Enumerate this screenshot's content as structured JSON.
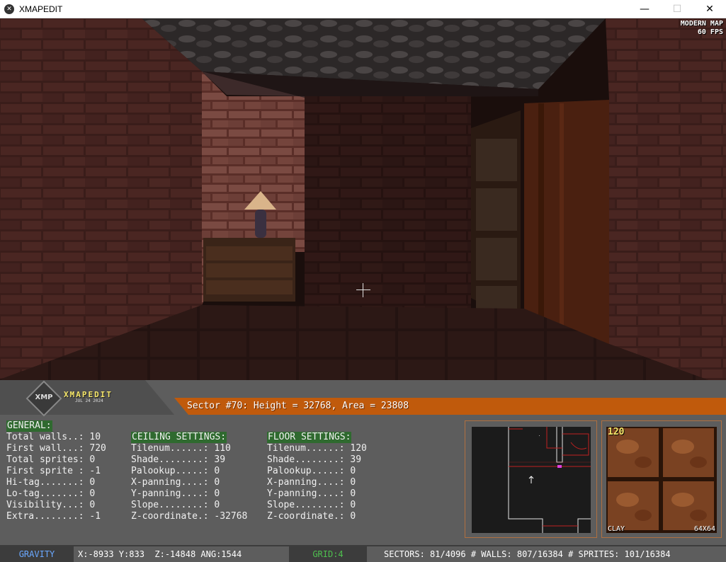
{
  "window": {
    "title": "XMAPEDIT",
    "minimize": "—",
    "maximize": "☐",
    "close": "✕"
  },
  "viewport": {
    "map_mode": "MODERN MAP",
    "fps": "60 FPS"
  },
  "logo": {
    "badge": "XMP",
    "name": "XMAPEDIT",
    "date": "JUL 24 2024"
  },
  "sector_info": "Sector #70: Height = 32768, Area = 23808",
  "general": {
    "header": "GENERAL:",
    "rows": [
      {
        "label": "Total walls..: ",
        "value": "10"
      },
      {
        "label": "First wall...: ",
        "value": "720"
      },
      {
        "label": "Total sprites: ",
        "value": "0"
      },
      {
        "label": "First sprite : ",
        "value": "-1"
      },
      {
        "label": "Hi-tag.......: ",
        "value": "0"
      },
      {
        "label": "Lo-tag.......: ",
        "value": "0"
      },
      {
        "label": "Visibility...: ",
        "value": "0"
      },
      {
        "label": "Extra........: ",
        "value": "-1"
      }
    ]
  },
  "ceiling": {
    "header": "CEILING SETTINGS:",
    "rows": [
      {
        "label": "Tilenum......: ",
        "value": "110"
      },
      {
        "label": "Shade........: ",
        "value": "39"
      },
      {
        "label": "Palookup.....: ",
        "value": "0"
      },
      {
        "label": "X-panning....: ",
        "value": "0"
      },
      {
        "label": "Y-panning....: ",
        "value": "0"
      },
      {
        "label": "Slope........: ",
        "value": "0"
      },
      {
        "label": "Z-coordinate.: ",
        "value": "-32768"
      }
    ]
  },
  "floor": {
    "header": "FLOOR SETTINGS:",
    "rows": [
      {
        "label": "Tilenum......: ",
        "value": "120"
      },
      {
        "label": "Shade........: ",
        "value": "39"
      },
      {
        "label": "Palookup.....: ",
        "value": "0"
      },
      {
        "label": "X-panning....: ",
        "value": "0"
      },
      {
        "label": "Y-panning....: ",
        "value": "0"
      },
      {
        "label": "Slope........: ",
        "value": "0"
      },
      {
        "label": "Z-coordinate.: ",
        "value": "0"
      }
    ]
  },
  "texture_preview": {
    "number": "120",
    "name": "CLAY",
    "size": "64X64"
  },
  "status": {
    "mode": "GRAVITY",
    "coords": "X:-8933 Y:833  Z:-14848 ANG:1544",
    "grid": "GRID:4",
    "counts": "SECTORS: 81/4096 # WALLS: 807/16384 # SPRITES: 101/16384"
  },
  "colors": {
    "accent_orange": "#c05a0c",
    "header_green": "#2f6a2f",
    "panel_gray": "#5d5d5d",
    "gravity_blue": "#6aa8ff",
    "grid_green": "#4fc04f",
    "logo_yellow": "#f5e66a"
  }
}
